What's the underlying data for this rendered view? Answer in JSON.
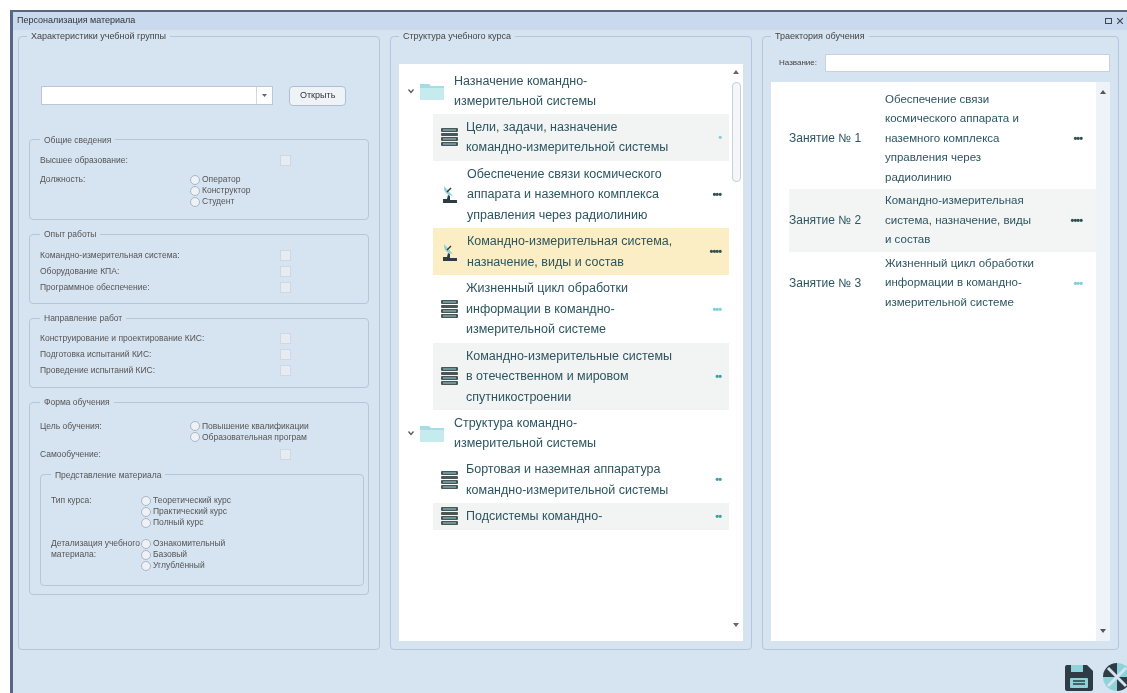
{
  "window": {
    "title": "Персонализация материала"
  },
  "group_panel": {
    "title": "Характеристики учебной группы",
    "open_button": "Открыть",
    "sections": [
      {
        "title": "Общие сведения",
        "fields": [
          {
            "kind": "checkbox",
            "label": "Высшее образование:",
            "checked": false
          },
          {
            "kind": "radio",
            "label": "Должность:",
            "options": [
              {
                "label": "Оператор",
                "selected": false
              },
              {
                "label": "Конструктор",
                "selected": false
              },
              {
                "label": "Студент",
                "selected": false
              }
            ]
          }
        ]
      },
      {
        "title": "Опыт работы",
        "fields": [
          {
            "kind": "checkbox",
            "label": "Командно-измерительная система:",
            "checked": false
          },
          {
            "kind": "checkbox",
            "label": "Оборудование КПА:",
            "checked": false
          },
          {
            "kind": "checkbox",
            "label": "Программное обеспечение:",
            "checked": false
          }
        ]
      },
      {
        "title": "Направление работ",
        "fields": [
          {
            "kind": "checkbox",
            "label": "Конструирование и проектирование  КИС:",
            "checked": false
          },
          {
            "kind": "checkbox",
            "label": "Подготовка испытаний КИС:",
            "checked": false
          },
          {
            "kind": "checkbox",
            "label": "Проведение испытаний КИС:",
            "checked": false
          }
        ]
      },
      {
        "title": "Форма обучения",
        "fields": [
          {
            "kind": "radio",
            "label": "Цель обучения:",
            "options": [
              {
                "label": "Повышение квалификации",
                "selected": false
              },
              {
                "label": "Образовательная програм",
                "selected": false
              }
            ]
          },
          {
            "kind": "checkbox",
            "label": "Самообучение:",
            "checked": false
          },
          {
            "kind": "group",
            "title": "Представление материала",
            "fields": [
              {
                "kind": "radio",
                "label": "Тип курса:",
                "options": [
                  {
                    "label": "Теоретический курс",
                    "selected": false
                  },
                  {
                    "label": "Практический курс",
                    "selected": false
                  },
                  {
                    "label": "Полный курс",
                    "selected": false
                  }
                ]
              },
              {
                "kind": "radio",
                "label": "Детализация учебного материала:",
                "options": [
                  {
                    "label": "Ознакомительный",
                    "selected": false
                  },
                  {
                    "label": "Базовый",
                    "selected": false
                  },
                  {
                    "label": "Углублённый",
                    "selected": false
                  }
                ]
              }
            ]
          }
        ]
      }
    ]
  },
  "course_tree": {
    "title": "Структура учебного курса",
    "items": [
      {
        "kind": "folder",
        "label": "Назначение командно-измерительной системы",
        "expanded": true,
        "children": [
          {
            "kind": "document",
            "label": "Цели, задачи, назначение командно-измерительной системы",
            "rating": "•",
            "color": "#7ecfd6",
            "selected": false
          },
          {
            "kind": "dish",
            "label": "Обеспечение связи космического аппарата и наземного комплекса управления через радиолинию",
            "rating": "•••",
            "color": "#2f4f52",
            "selected": false
          },
          {
            "kind": "dish",
            "label": "Командно-измерительная система, назначение, виды и состав",
            "rating": "••••",
            "color": "#2f4f52",
            "selected": true
          },
          {
            "kind": "document",
            "label": "Жизненный цикл обработки информации в командно-измерительной системе",
            "rating": "•••",
            "color": "#7ecfd6",
            "selected": false
          },
          {
            "kind": "document",
            "label": "Командно-измерительные системы в отечественном и мировом спутникостроении",
            "rating": "••",
            "color": "#3b9ea5",
            "selected": false
          }
        ]
      },
      {
        "kind": "folder",
        "label": "Структура командно-измерительной системы",
        "expanded": true,
        "children": [
          {
            "kind": "document",
            "label": "Бортовая и наземная аппаратура командно-измерительной системы",
            "rating": "••",
            "color": "#3b9ea5",
            "selected": false
          },
          {
            "kind": "document",
            "label": "Подсистемы командно-",
            "rating": "••",
            "color": "#3b9ea5",
            "selected": false
          }
        ]
      }
    ]
  },
  "trajectory": {
    "title": "Траектория обучения",
    "name_label": "Название:",
    "lessons": [
      {
        "label": "Занятие № 1",
        "topic": "Обеспечение связи космического аппарата и наземного комплекса управления через радиолинию",
        "rating": "•••",
        "color": "#2f4f52"
      },
      {
        "label": "Занятие № 2",
        "topic": "Командно-измерительная система, назначение, виды и состав",
        "rating": "••••",
        "color": "#2f4f52"
      },
      {
        "label": "Занятие № 3",
        "topic": "Жизненный цикл обработки информации в командно-измерительной системе",
        "rating": "•••",
        "color": "#7ecfd6"
      }
    ]
  }
}
